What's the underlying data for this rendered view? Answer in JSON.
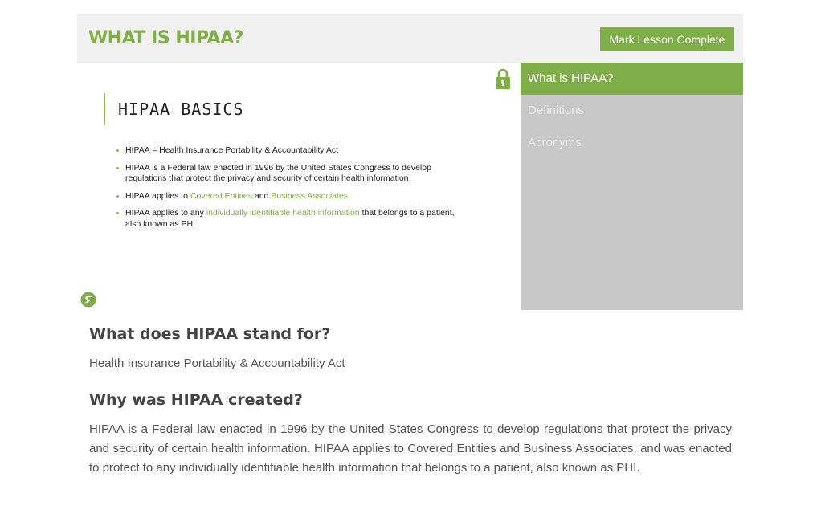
{
  "header": {
    "title": "WHAT IS HIPAA?",
    "mark_complete_label": "Mark Lesson Complete"
  },
  "slide": {
    "heading": "HIPAA BASICS",
    "bullets": {
      "b1": "HIPAA = Health Insurance Portability & Accountability Act",
      "b2": "HIPAA is a Federal law enacted in 1996 by the United States Congress to develop regulations that protect the privacy and security of certain health information",
      "b3_pre": "HIPAA applies to ",
      "b3_link1": "Covered Entities",
      "b3_mid": " and ",
      "b3_link2": "Business Associates",
      "b4_pre": "HIPAA applies to any ",
      "b4_link": "individually identifiable health information",
      "b4_post": " that belongs to a patient, also known as PHI"
    }
  },
  "nav": {
    "items": [
      {
        "label": "What is HIPAA?",
        "active": true
      },
      {
        "label": "Definitions",
        "active": false
      },
      {
        "label": "Acronyms",
        "active": false
      }
    ]
  },
  "content": {
    "q1": "What does HIPAA stand for?",
    "a1": "Health Insurance Portability & Accountability Act",
    "q2": "Why was HIPAA created?",
    "a2": "HIPAA is a Federal law enacted in 1996 by the United States Congress to develop regulations that protect the privacy and security of certain health information. HIPAA applies to Covered Entities and Business Associates, and was enacted to protect to any individually identifiable health information that belongs to a patient, also known as PHI."
  },
  "icons": {
    "lock": "lock-icon",
    "logo": "logo-icon"
  },
  "colors": {
    "accent": "#7fae48",
    "nav_bg": "#c8c8c8",
    "header_bg": "#f1f1f1"
  }
}
